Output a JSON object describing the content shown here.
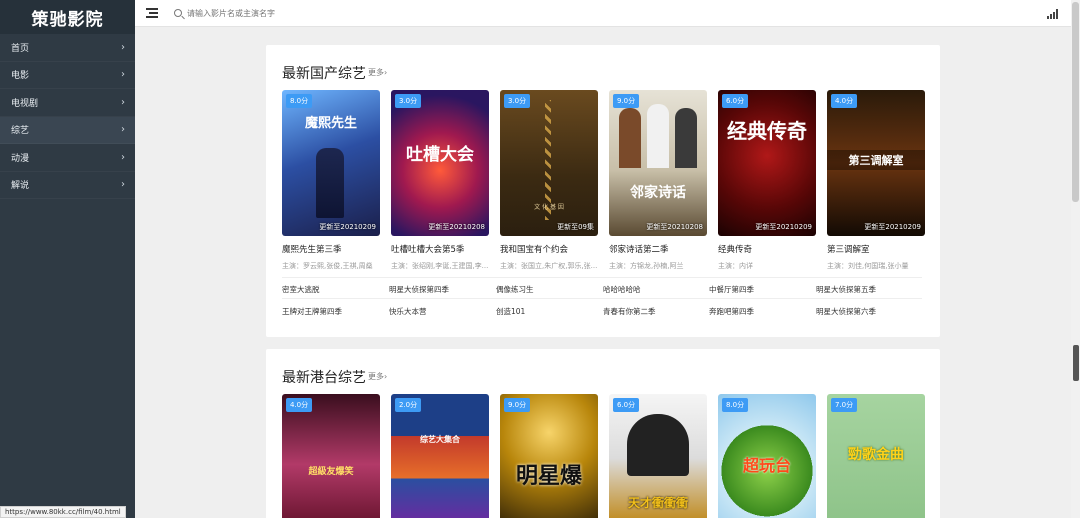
{
  "sidebar": {
    "logo": "策驰影院",
    "items": [
      {
        "label": "首页"
      },
      {
        "label": "电影"
      },
      {
        "label": "电视剧"
      },
      {
        "label": "综艺"
      },
      {
        "label": "动漫"
      },
      {
        "label": "解说"
      }
    ],
    "active_index": 3
  },
  "topbar": {
    "search_placeholder": "请输入影片名或主演名字"
  },
  "sections": [
    {
      "title": "最新国产综艺",
      "more": "更多›",
      "cards": [
        {
          "badge": "8.0分",
          "update": "更新至20210209",
          "title": "魔熙先生第三季",
          "cast": "主演：罗云熙,张俊,王祺,周燊",
          "poster_text": "魔熙先生"
        },
        {
          "badge": "3.0分",
          "update": "更新至20210208",
          "title": "吐槽吐槽大会第5季",
          "cast": "主演：张绍刚,李诞,王建国,李...",
          "poster_text": "吐槽大会"
        },
        {
          "badge": "3.0分",
          "update": "更新至09集",
          "title": "我和国宝有个约会",
          "cast": "主演：张国立,朱广权,郭乐,张...",
          "poster_text": "文 化 基 因"
        },
        {
          "badge": "9.0分",
          "update": "更新至20210208",
          "title": "邻家诗话第二季",
          "cast": "主演：方锦龙,孙楠,阿兰",
          "poster_text": "邻家诗话"
        },
        {
          "badge": "6.0分",
          "update": "更新至20210209",
          "title": "经典传奇",
          "cast": "主演：内详",
          "poster_text": "经典传奇"
        },
        {
          "badge": "4.0分",
          "update": "更新至20210209",
          "title": "第三调解室",
          "cast": "主演：刘佳,何国瑞,张小量",
          "poster_text": "第三调解室"
        }
      ],
      "links": [
        [
          "密室大逃脱",
          "明星大侦探第四季",
          "偶像练习生",
          "哈哈哈哈哈",
          "中餐厅第四季",
          "明星大侦探第五季"
        ],
        [
          "王牌对王牌第四季",
          "快乐大本营",
          "创造101",
          "青春有你第二季",
          "奔跑吧第四季",
          "明星大侦探第六季"
        ]
      ]
    },
    {
      "title": "最新港台综艺",
      "more": "更多›",
      "cards": [
        {
          "badge": "4.0分",
          "poster_text": "超級友爆笑"
        },
        {
          "badge": "2.0分",
          "poster_text": "综艺大集合"
        },
        {
          "badge": "9.0分",
          "poster_text": "明星爆"
        },
        {
          "badge": "6.0分",
          "poster_text": "天才衝衝衝"
        },
        {
          "badge": "8.0分",
          "poster_text": "超玩台"
        },
        {
          "badge": "7.0分",
          "poster_text": "勁歌金曲"
        }
      ]
    }
  ],
  "status_url": "https://www.80kk.cc/film/40.html"
}
